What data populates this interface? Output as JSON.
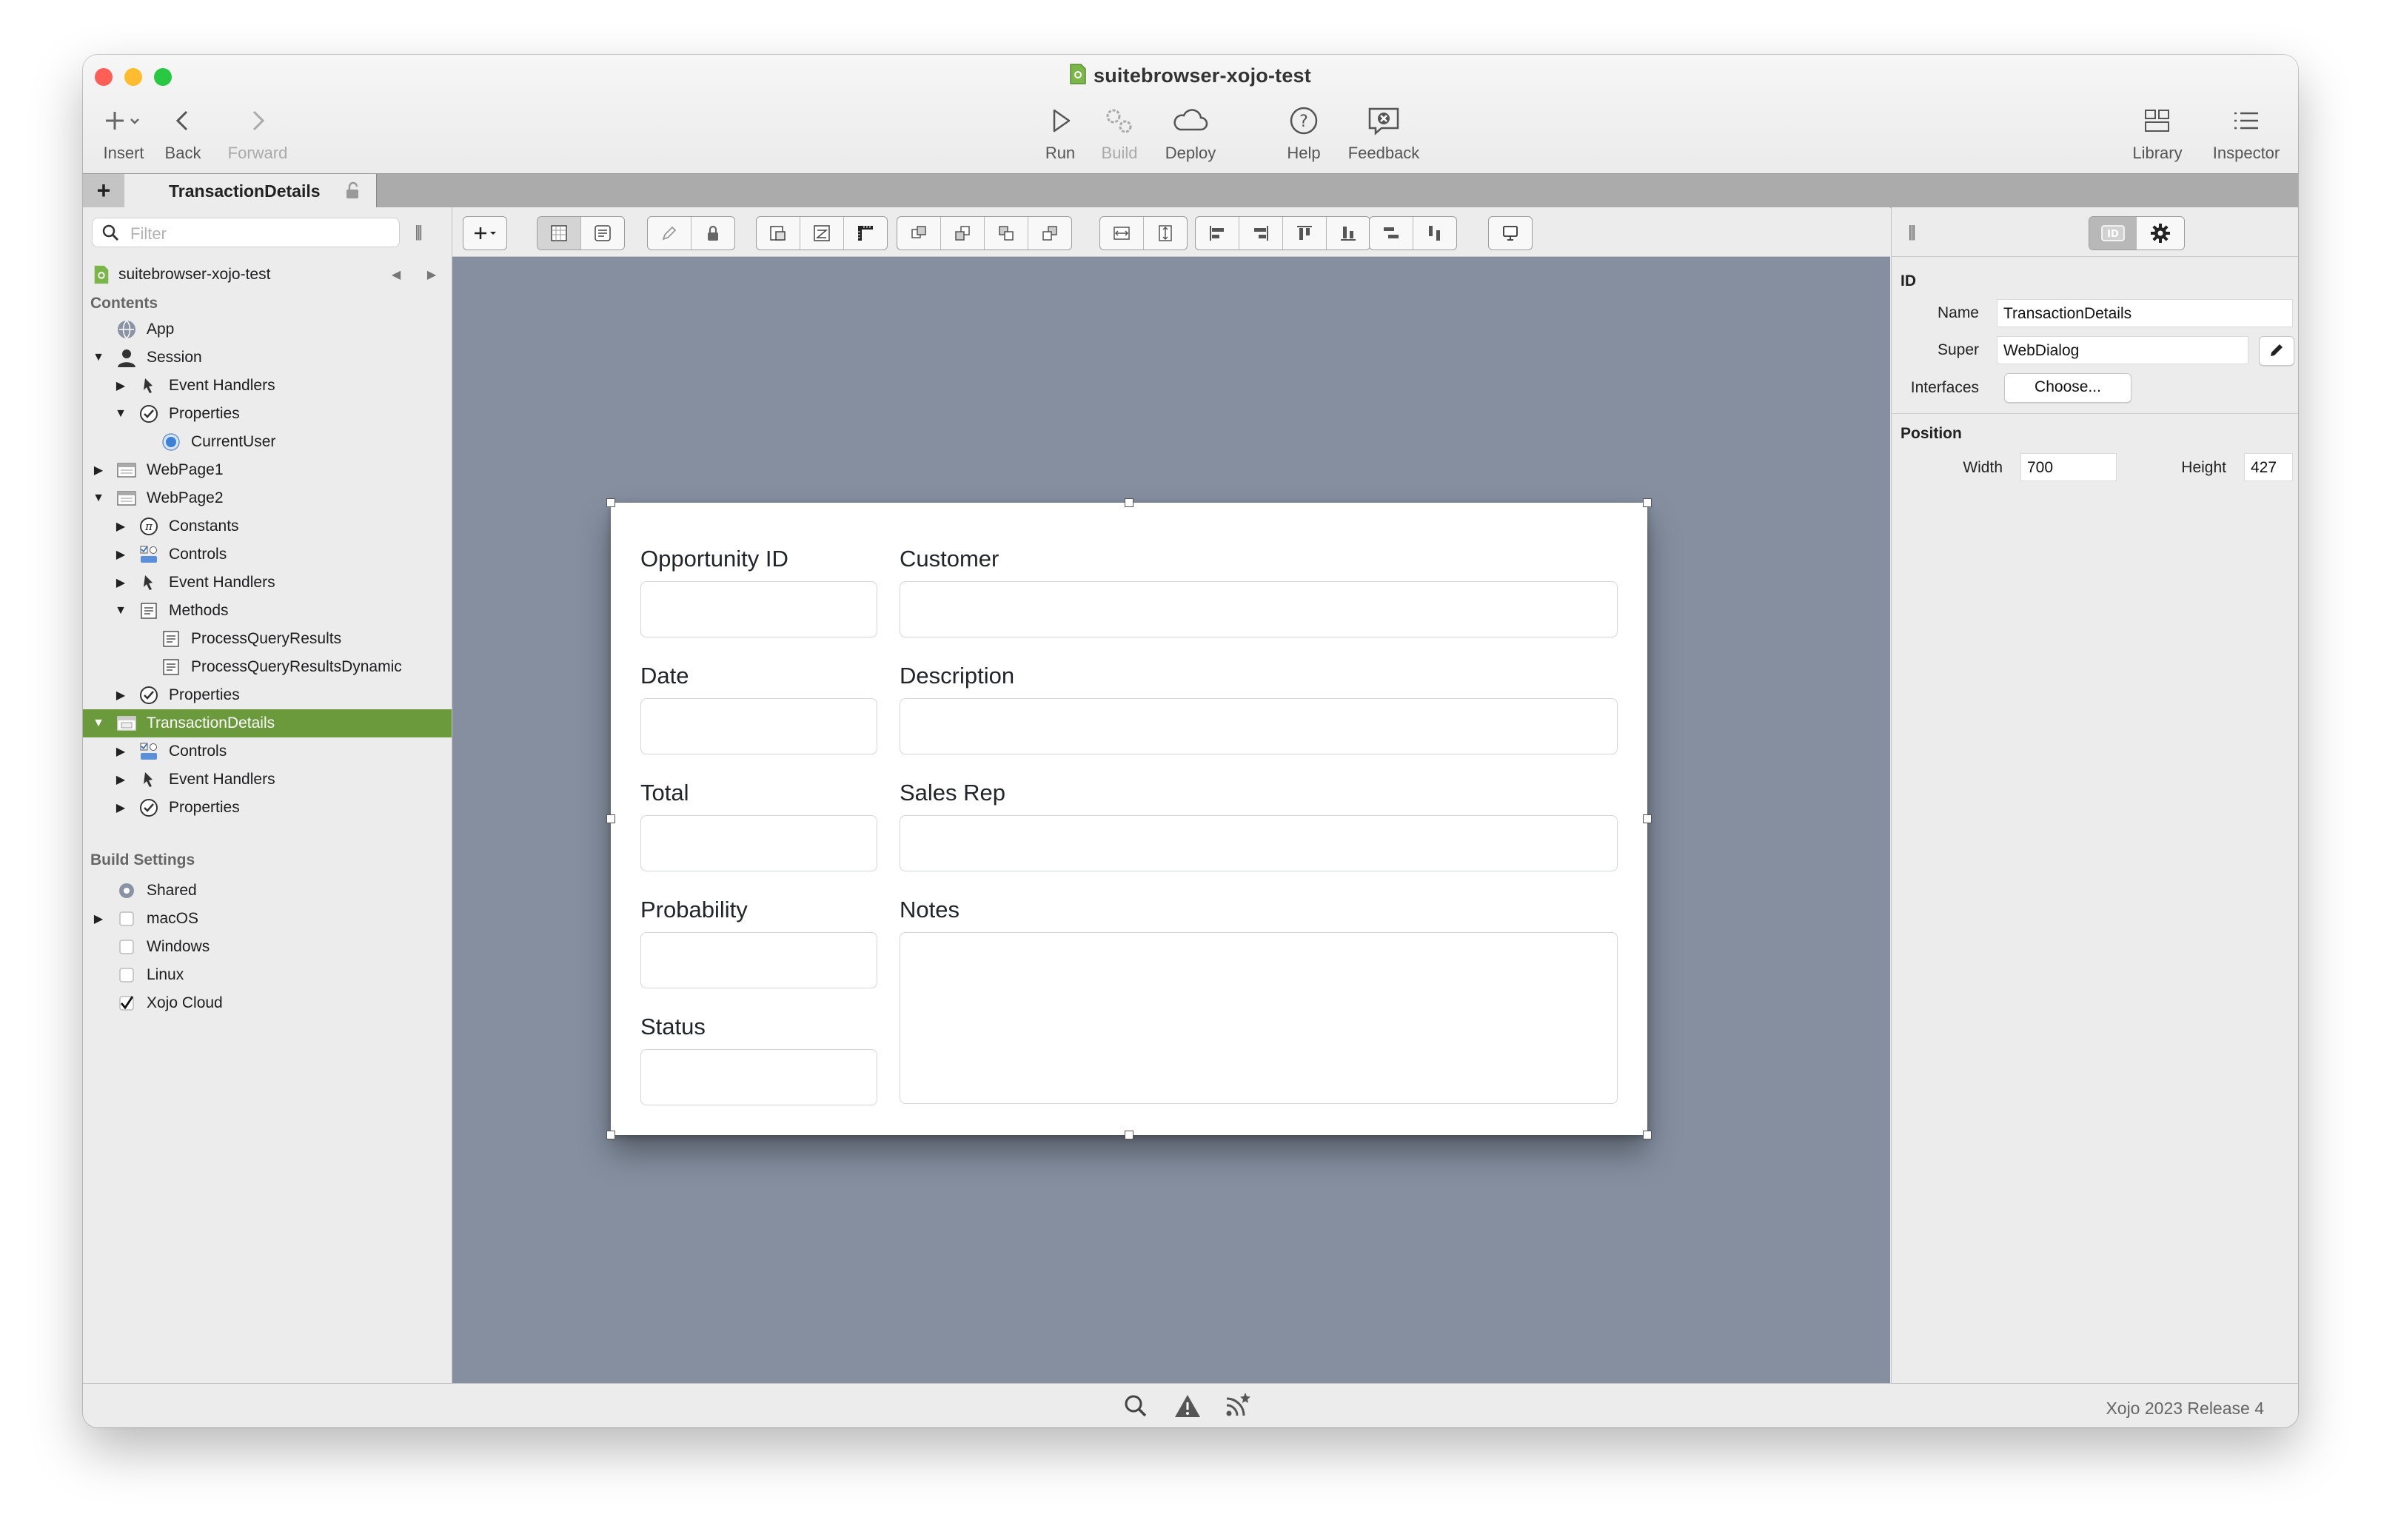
{
  "window": {
    "title": "suitebrowser-xojo-test"
  },
  "toolbar": {
    "insert": "Insert",
    "back": "Back",
    "forward": "Forward",
    "run": "Run",
    "build": "Build",
    "deploy": "Deploy",
    "help": "Help",
    "feedback": "Feedback",
    "library": "Library",
    "inspector": "Inspector"
  },
  "tabs": {
    "active": "TransactionDetails",
    "add": "+"
  },
  "navigator": {
    "filter_placeholder": "Filter",
    "project": "suitebrowser-xojo-test",
    "contents_header": "Contents",
    "build_header": "Build Settings",
    "items": [
      "App",
      "Session",
      "Event Handlers",
      "Properties",
      "CurrentUser",
      "WebPage1",
      "WebPage2",
      "Constants",
      "Controls",
      "Event Handlers",
      "Methods",
      "ProcessQueryResults",
      "ProcessQueryResultsDynamic",
      "Properties",
      "TransactionDetails",
      "Controls",
      "Event Handlers",
      "Properties"
    ],
    "build_items": [
      "Shared",
      "macOS",
      "Windows",
      "Linux",
      "Xojo Cloud"
    ]
  },
  "dialog": {
    "labels": {
      "opportunity_id": "Opportunity ID",
      "customer": "Customer",
      "date": "Date",
      "description": "Description",
      "total": "Total",
      "sales_rep": "Sales Rep",
      "probability": "Probability",
      "notes": "Notes",
      "status": "Status"
    }
  },
  "inspector": {
    "id_header": "ID",
    "name_label": "Name",
    "name_value": "TransactionDetails",
    "super_label": "Super",
    "super_value": "WebDialog",
    "interfaces_label": "Interfaces",
    "choose_button": "Choose...",
    "position_header": "Position",
    "width_label": "Width",
    "width_value": "700",
    "height_label": "Height",
    "height_value": "427"
  },
  "status": {
    "version": "Xojo 2023 Release 4"
  },
  "colors": {
    "selection": "#6a9a3b",
    "canvas": "#858fa0",
    "close": "#ff5f57",
    "minimize": "#febc2e",
    "zoom": "#28c840"
  }
}
